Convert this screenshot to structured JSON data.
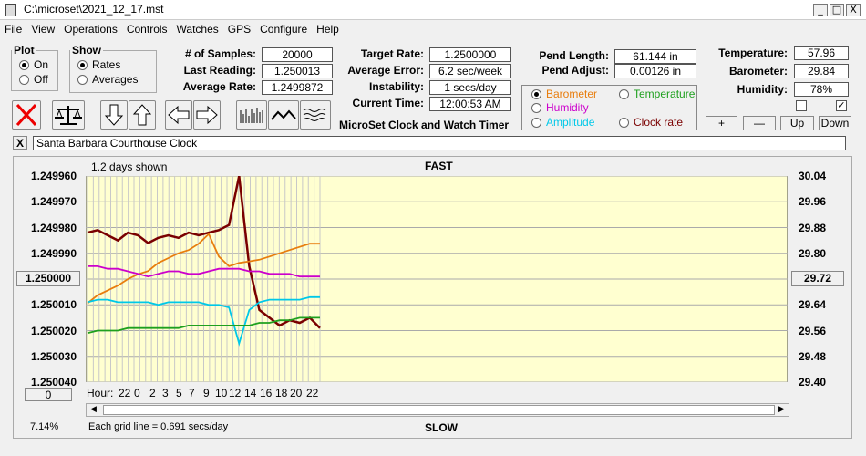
{
  "window": {
    "title": "C:\\microset\\2021_12_17.mst",
    "min": "_",
    "max": "□",
    "close": "X"
  },
  "menu": [
    "File",
    "View",
    "Operations",
    "Controls",
    "Watches",
    "GPS",
    "Configure",
    "Help"
  ],
  "plot": {
    "legend": "Plot",
    "on": "On",
    "off": "Off",
    "selected": "On"
  },
  "show": {
    "legend": "Show",
    "rates": "Rates",
    "averages": "Averages",
    "selected": "Rates"
  },
  "stats": {
    "samples": {
      "label": "# of Samples:",
      "value": "20000"
    },
    "last": {
      "label": "Last Reading:",
      "value": "1.250013"
    },
    "avg": {
      "label": "Average Rate:",
      "value": "1.2499872"
    },
    "target": {
      "label": "Target Rate:",
      "value": "1.2500000"
    },
    "avgerr": {
      "label": "Average Error:",
      "value": "6.2 sec/week"
    },
    "instab": {
      "label": "Instability:",
      "value": "1 secs/day"
    },
    "time": {
      "label": "Current Time:",
      "value": "12:00:53 AM"
    },
    "pendlen": {
      "label": "Pend Length:",
      "value": "61.144 in"
    },
    "pendadj": {
      "label": "Pend Adjust:",
      "value": "0.00126 in"
    },
    "temp": {
      "label": "Temperature:",
      "value": "57.96"
    },
    "baro": {
      "label": "Barometer:",
      "value": "29.84"
    },
    "humid": {
      "label": "Humidity:",
      "value": "78%"
    }
  },
  "app_title": "MicroSet Clock and Watch Timer",
  "sensors": {
    "barometer": {
      "label": "Barometer",
      "color": "#e87d0d",
      "selected": true
    },
    "temperature": {
      "label": "Temperature",
      "color": "#1ea01e",
      "selected": false
    },
    "humidity": {
      "label": "Humidity",
      "color": "#cc00cc",
      "selected": false
    },
    "amplitude": {
      "label": "Amplitude",
      "color": "#00c8e8",
      "selected": false
    },
    "clockrate": {
      "label": "Clock rate",
      "color": "#7a0000",
      "selected": false
    }
  },
  "checks": {
    "first": "",
    "second": "✓"
  },
  "buttons": {
    "plus": "+",
    "minus": "—",
    "up": "Up",
    "down": "Down",
    "close_x": "X"
  },
  "clock_name": "Santa Barbara Courthouse Clock",
  "chart_header": {
    "days": "1.2 days shown",
    "fast": "FAST",
    "slow": "SLOW",
    "grid": "Each grid line = 0.691 secs/day",
    "pct": "7.14%",
    "hour": "Hour:",
    "left_btn": "1.250000",
    "right_btn": "29.72",
    "zero_btn": "0"
  },
  "chart_data": {
    "type": "line",
    "xlabel": "Hour:",
    "x_ticks": [
      "22",
      "0",
      "2",
      "3",
      "5",
      "7",
      "9",
      "10",
      "12",
      "14",
      "16",
      "18",
      "20",
      "22"
    ],
    "left_axis": {
      "ticks": [
        "1.249960",
        "1.249970",
        "1.249980",
        "1.249990",
        "1.250000",
        "1.250010",
        "1.250020",
        "1.250030",
        "1.250040"
      ],
      "range": [
        1.24996,
        1.25004
      ],
      "inverted": true
    },
    "right_axis": {
      "ticks": [
        "30.04",
        "29.96",
        "29.88",
        "29.80",
        "29.72",
        "29.64",
        "29.56",
        "29.48",
        "29.40"
      ],
      "range": [
        29.4,
        30.04
      ]
    },
    "background": "#ffffd0",
    "series": [
      {
        "name": "Clock rate",
        "color": "#7a0000",
        "axis": "left",
        "y": [
          1.249982,
          1.249981,
          1.249983,
          1.249985,
          1.249982,
          1.249983,
          1.249986,
          1.249984,
          1.249983,
          1.249984,
          1.249982,
          1.249983,
          1.249982,
          1.249981,
          1.249979,
          1.24996,
          1.249995,
          1.250012,
          1.250015,
          1.250018,
          1.250016,
          1.250017,
          1.250015,
          1.250019
        ]
      },
      {
        "name": "Barometer",
        "color": "#e87d0d",
        "axis": "right",
        "y": [
          29.645,
          29.67,
          29.685,
          29.7,
          29.72,
          29.735,
          29.745,
          29.77,
          29.785,
          29.8,
          29.81,
          29.83,
          29.86,
          29.79,
          29.76,
          29.77,
          29.775,
          29.78,
          29.79,
          29.8,
          29.81,
          29.82,
          29.83,
          29.83
        ]
      },
      {
        "name": "Humidity",
        "color": "#cc00cc",
        "axis": "left",
        "y": [
          1.249995,
          1.249995,
          1.249996,
          1.249996,
          1.249997,
          1.249998,
          1.249999,
          1.249998,
          1.249997,
          1.249997,
          1.249998,
          1.249998,
          1.249997,
          1.249996,
          1.249996,
          1.249996,
          1.249997,
          1.249997,
          1.249998,
          1.249998,
          1.249998,
          1.249999,
          1.249999,
          1.249999
        ]
      },
      {
        "name": "Amplitude",
        "color": "#00c8e8",
        "axis": "left",
        "y": [
          1.250009,
          1.250008,
          1.250008,
          1.250009,
          1.250009,
          1.250009,
          1.250009,
          1.25001,
          1.250009,
          1.250009,
          1.250009,
          1.250009,
          1.25001,
          1.25001,
          1.250011,
          1.250025,
          1.250012,
          1.250009,
          1.250008,
          1.250008,
          1.250008,
          1.250008,
          1.250007,
          1.250007
        ]
      },
      {
        "name": "Temperature",
        "color": "#1ea01e",
        "axis": "left",
        "y": [
          1.250021,
          1.25002,
          1.25002,
          1.25002,
          1.250019,
          1.250019,
          1.250019,
          1.250019,
          1.250019,
          1.250019,
          1.250018,
          1.250018,
          1.250018,
          1.250018,
          1.250018,
          1.250018,
          1.250018,
          1.250017,
          1.250017,
          1.250016,
          1.250016,
          1.250015,
          1.250015,
          1.250015
        ]
      }
    ]
  }
}
